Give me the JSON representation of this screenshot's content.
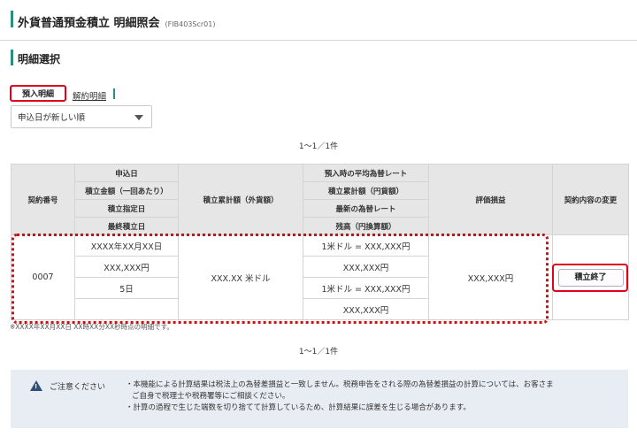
{
  "page": {
    "title": "外貨普通預金積立 明細照会",
    "code": "(FIB403Scr01)",
    "section_title": "明細選択"
  },
  "tabs": {
    "active": "預入明細",
    "other": "解約明細"
  },
  "sort": {
    "selected": "申込日が新しい順"
  },
  "pager": {
    "top": "1〜1／1件",
    "bottom": "1〜1／1件"
  },
  "table": {
    "headers": {
      "contract_no": "契約番号",
      "apply_date": "申込日",
      "amount_per": "積立金額（一回あたり）",
      "designated_day": "積立指定日",
      "last_date": "最終積立日",
      "total_fc": "積立累計額（外貨額）",
      "avg_rate": "預入時の平均為替レート",
      "total_jpy": "積立累計額（円貨額）",
      "latest_rate": "最新の為替レート",
      "balance_jpy": "残高（円換算額）",
      "pnl": "評価損益",
      "change": "契約内容の変更"
    },
    "row": {
      "contract_no": "0007",
      "apply_date": "XXXX年XX月XX日",
      "amount_per": "XXX,XXX円",
      "designated_day": "5日",
      "last_date": "",
      "total_fc": "XXX.XX 米ドル",
      "avg_rate": "1米ドル = XXX,XXX円",
      "total_jpy": "XXX,XXX円",
      "latest_rate": "1米ドル = XXX,XXX円",
      "balance_jpy": "XXX,XXX円",
      "pnl": "XXX,XXX円",
      "end_button": "積立終了"
    }
  },
  "note": "※XXXX年XX月XX日 XX時XX分XX秒時点の明細です。",
  "caution": {
    "label": "ご注意ください",
    "line1": "・本機能による計算結果は税法上の為替差損益と一致しません。税務申告をされる際の為替差損益の計算については、お客さま",
    "line2": "ご自身で税理士や税務署等にご相談ください。",
    "line3": "・計算の過程で生じた端数を切り捨てて計算しているため、計算結果に誤差を生じる場合があります。"
  },
  "colors": {
    "accent_green": "#2a8f7e",
    "highlight_red": "#e0001b",
    "header_gray": "#e6e6e6",
    "caution_bg": "#e8edf3"
  }
}
